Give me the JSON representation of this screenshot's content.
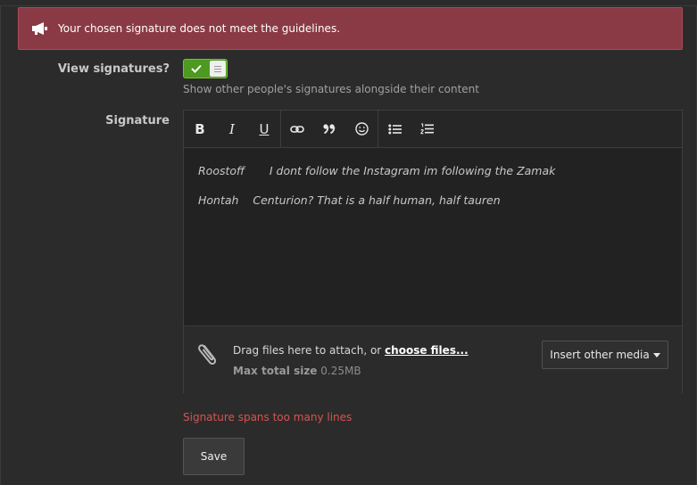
{
  "alert": {
    "message": "Your chosen signature does not meet the guidelines."
  },
  "view_signatures": {
    "label": "View signatures?",
    "enabled": true,
    "hint": "Show other people's signatures alongside their content"
  },
  "signature": {
    "label": "Signature",
    "toolbar": {
      "bold": "B",
      "italic": "I",
      "underline": "U",
      "buttons": [
        "bold",
        "italic",
        "underline",
        "link",
        "quote",
        "smilie",
        "bullet-list",
        "numbered-list"
      ]
    },
    "lines": [
      "Roostoff       I dont follow the Instagram im following the Zamak",
      "Hontah    Centurion? That is a half human, half tauren"
    ],
    "attach": {
      "drag_text": "Drag files here to attach, or ",
      "choose_link": "choose files...",
      "max_label": "Max total size",
      "max_value": "0.25MB"
    },
    "insert_media": "Insert other media"
  },
  "error": "Signature spans too many lines",
  "save_label": "Save",
  "colors": {
    "alert_bg": "#8a3a45",
    "toggle_on": "#4c9a1f",
    "error_text": "#d9534f"
  }
}
